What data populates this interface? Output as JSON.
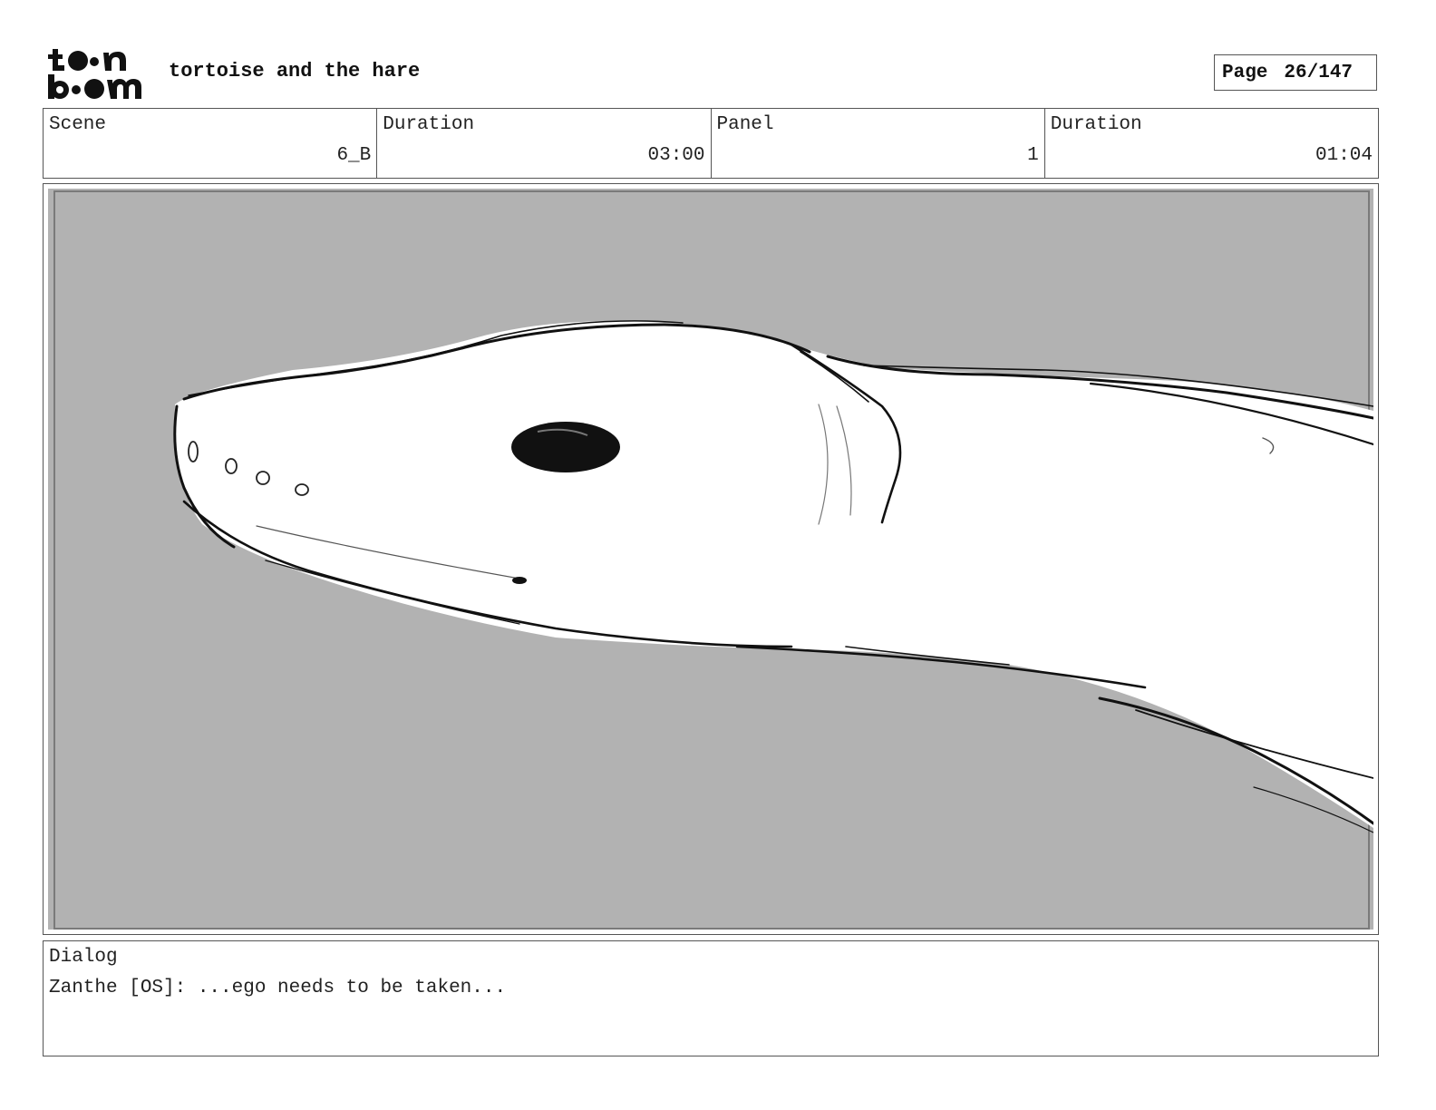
{
  "header": {
    "logo_line1": "toon",
    "logo_line2": "boom",
    "project_title": "tortoise and the hare",
    "page_label": "Page",
    "page_number": "26/147"
  },
  "info": {
    "scene_label": "Scene",
    "scene_value": "6_B",
    "scene_duration_label": "Duration",
    "scene_duration_value": "03:00",
    "panel_label": "Panel",
    "panel_value": "1",
    "panel_duration_label": "Duration",
    "panel_duration_value": "01:04"
  },
  "panel": {
    "background_color": "#b2b2b2",
    "drawing_fill": "#ffffff",
    "stroke_color": "#111111"
  },
  "dialog": {
    "label": "Dialog",
    "text": "Zanthe [OS]: ...ego needs to be taken..."
  }
}
